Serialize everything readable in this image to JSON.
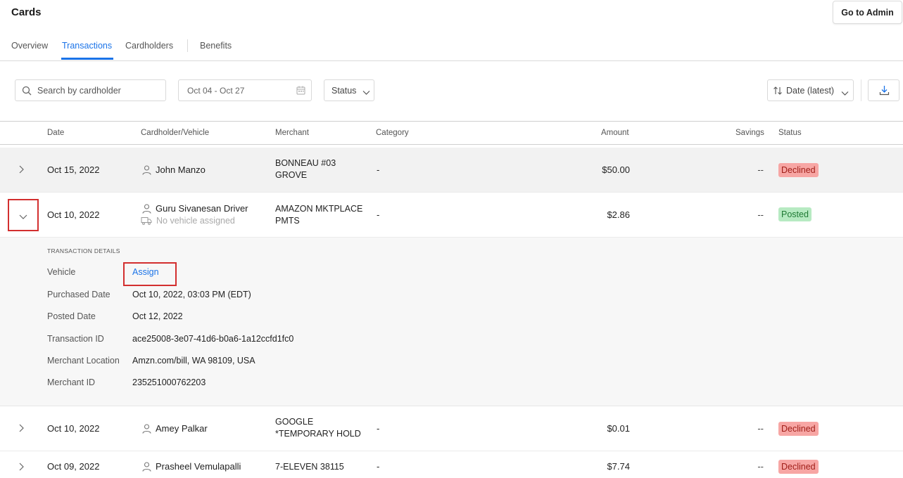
{
  "header": {
    "title": "Cards",
    "admin_button": "Go to Admin"
  },
  "tabs": [
    {
      "label": "Overview",
      "active": false
    },
    {
      "label": "Transactions",
      "active": true
    },
    {
      "label": "Cardholders",
      "active": false
    },
    {
      "label": "Benefits",
      "active": false
    }
  ],
  "filters": {
    "search_placeholder": "Search by cardholder",
    "search_value": "",
    "date_range": "Oct 04 - Oct 27",
    "status_label": "Status",
    "sort_label": "Date (latest)"
  },
  "table": {
    "columns": [
      "Date",
      "Cardholder/Vehicle",
      "Merchant",
      "Category",
      "Amount",
      "Savings",
      "Status"
    ],
    "rows": [
      {
        "date": "Oct 15, 2022",
        "cardholder": "John Manzo",
        "vehicle": "",
        "merchant_line1": "BONNEAU #03",
        "merchant_line2": "GROVE",
        "category": "-",
        "amount": "$50.00",
        "savings": "--",
        "status": "Declined"
      },
      {
        "date": "Oct 10, 2022",
        "cardholder": "Guru Sivanesan Driver",
        "vehicle": "No vehicle assigned",
        "merchant_line1": "AMAZON MKTPLACE",
        "merchant_line2": "PMTS",
        "category": "-",
        "amount": "$2.86",
        "savings": "--",
        "status": "Posted"
      },
      {
        "date": "Oct 10, 2022",
        "cardholder": "Amey Palkar",
        "vehicle": "",
        "merchant_line1": "GOOGLE",
        "merchant_line2": "*TEMPORARY HOLD",
        "category": "-",
        "amount": "$0.01",
        "savings": "--",
        "status": "Declined"
      },
      {
        "date": "Oct 09, 2022",
        "cardholder": "Prasheel Vemulapalli",
        "vehicle": "",
        "merchant_line1": "7-ELEVEN 38115",
        "merchant_line2": "",
        "category": "-",
        "amount": "$7.74",
        "savings": "--",
        "status": "Declined"
      }
    ]
  },
  "details": {
    "title": "TRANSACTION DETAILS",
    "vehicle_label": "Vehicle",
    "vehicle_action": "Assign",
    "purchased_label": "Purchased Date",
    "purchased_value": "Oct 10, 2022, 03:03 PM (EDT)",
    "posted_label": "Posted Date",
    "posted_value": "Oct 12, 2022",
    "txn_id_label": "Transaction ID",
    "txn_id_value": "ace25008-3e07-41d6-b0a6-1a12ccfd1fc0",
    "location_label": "Merchant Location",
    "location_value": "Amzn.com/bill, WA 98109, USA",
    "merchant_id_label": "Merchant ID",
    "merchant_id_value": "235251000762203"
  },
  "colors": {
    "accent": "#1a73e8",
    "declined_bg": "#f7a6a4",
    "posted_bg": "#b7eac2",
    "highlight": "#d32f2f"
  }
}
